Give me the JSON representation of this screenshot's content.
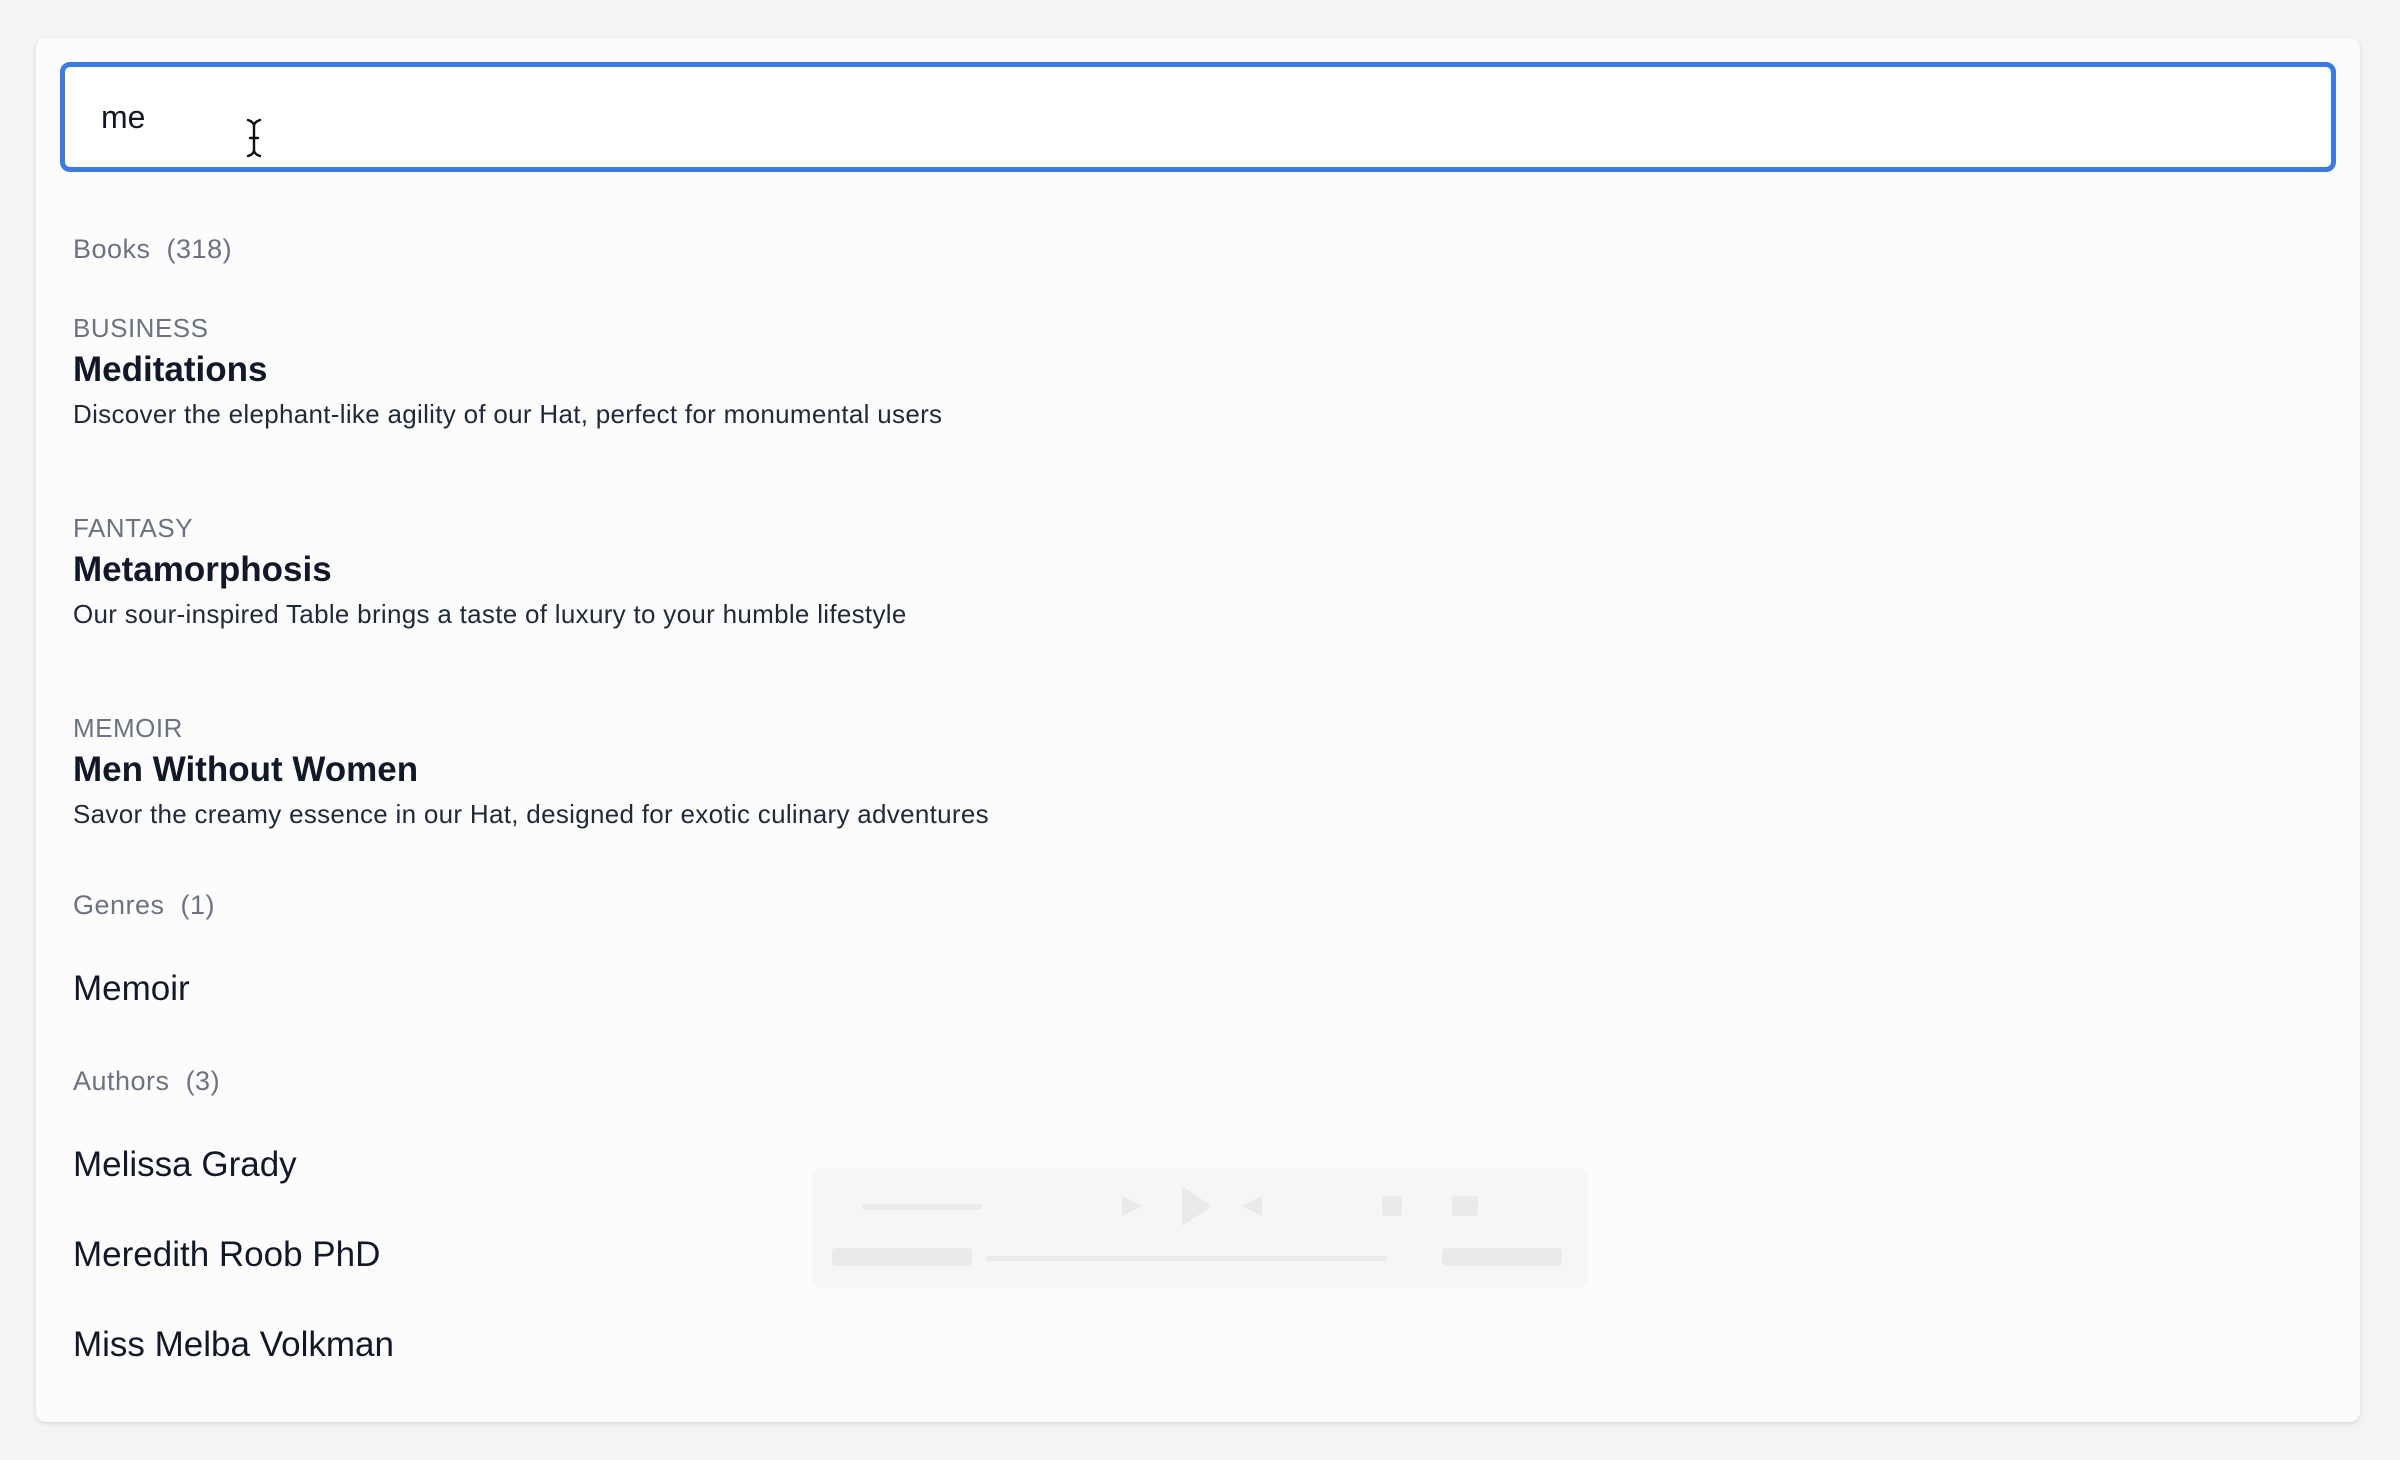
{
  "search": {
    "value": "me",
    "placeholder": ""
  },
  "sections": {
    "books": {
      "label": "Books",
      "count": "(318)",
      "items": [
        {
          "category": "BUSINESS",
          "title": "Meditations",
          "description": "Discover the elephant-like agility of our Hat, perfect for monumental users"
        },
        {
          "category": "FANTASY",
          "title": "Metamorphosis",
          "description": "Our sour-inspired Table brings a taste of luxury to your humble lifestyle"
        },
        {
          "category": "MEMOIR",
          "title": "Men Without Women",
          "description": "Savor the creamy essence in our Hat, designed for exotic culinary adventures"
        }
      ]
    },
    "genres": {
      "label": "Genres",
      "count": "(1)",
      "items": [
        "Memoir"
      ]
    },
    "authors": {
      "label": "Authors",
      "count": "(3)",
      "items": [
        "Melissa Grady",
        "Meredith Roob PhD",
        "Miss Melba Volkman"
      ]
    }
  },
  "colors": {
    "focus_ring": "#3b7be0",
    "muted_text": "#6b7280",
    "background": "#f3f4f6"
  },
  "icons": {
    "cursor": "text-cursor-icon"
  }
}
